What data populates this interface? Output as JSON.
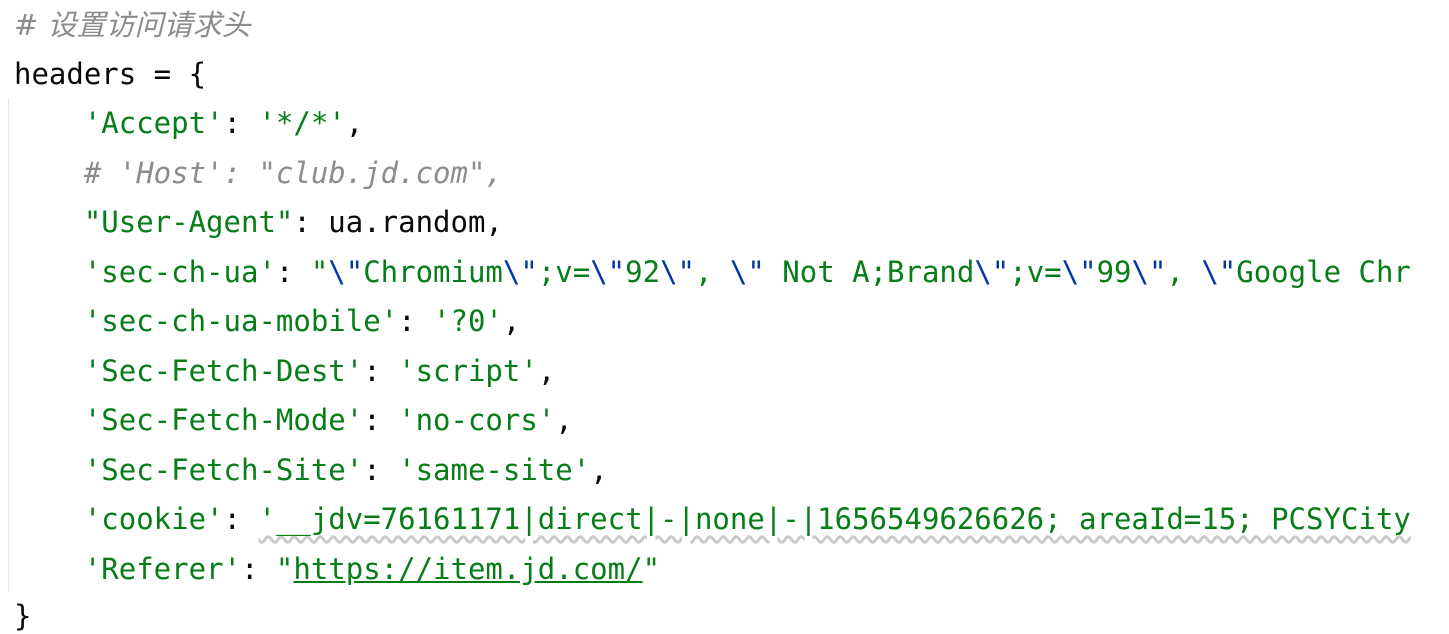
{
  "code": {
    "comment_title": "# 设置访问请求头",
    "var_name": "headers",
    "assign_open": " = {",
    "accept_key": "'Accept'",
    "accept_colon": ": ",
    "accept_value": "'*/*'",
    "accept_comma": ",",
    "host_comment": "# 'Host': \"club.jd.com\",",
    "ua_key": "\"User-Agent\"",
    "ua_colon": ": ",
    "ua_value": "ua.random",
    "ua_comma": ",",
    "secchua_key": "'sec-ch-ua'",
    "secchua_colon": ": ",
    "secchua_q0": "\"",
    "secchua_e1": "\\\"",
    "secchua_s1": "Chromium",
    "secchua_e2": "\\\"",
    "secchua_s2": ";v=",
    "secchua_e3": "\\\"",
    "secchua_s3": "92",
    "secchua_e4": "\\\"",
    "secchua_s4": ", ",
    "secchua_e5": "\\\"",
    "secchua_s5": " Not A;Brand",
    "secchua_e6": "\\\"",
    "secchua_s6": ";v=",
    "secchua_e7": "\\\"",
    "secchua_s7": "99",
    "secchua_e8": "\\\"",
    "secchua_s8": ", ",
    "secchua_e9": "\\\"",
    "secchua_s9": "Google Chr",
    "mobile_key": "'sec-ch-ua-mobile'",
    "mobile_colon": ": ",
    "mobile_value": "'?0'",
    "mobile_comma": ",",
    "dest_key": "'Sec-Fetch-Dest'",
    "dest_colon": ": ",
    "dest_value": "'script'",
    "dest_comma": ",",
    "mode_key": "'Sec-Fetch-Mode'",
    "mode_colon": ": ",
    "mode_value": "'no-cors'",
    "mode_comma": ",",
    "site_key": "'Sec-Fetch-Site'",
    "site_colon": ": ",
    "site_value": "'same-site'",
    "site_comma": ",",
    "cookie_key": "'cookie'",
    "cookie_colon": ": ",
    "cookie_value": "'__jdv=76161171|direct|-|none|-|1656549626626; areaId=15; PCSYCity",
    "referer_key": "'Referer'",
    "referer_colon": ": ",
    "referer_q_open": "\"",
    "referer_url": "https://item.jd.com/",
    "referer_q_close": "\"",
    "close_brace": "}"
  },
  "colors": {
    "string": "#067d17",
    "escape": "#0037a6",
    "comment": "#8c8c8c",
    "identifier": "#080808",
    "background": "#ffffff"
  }
}
